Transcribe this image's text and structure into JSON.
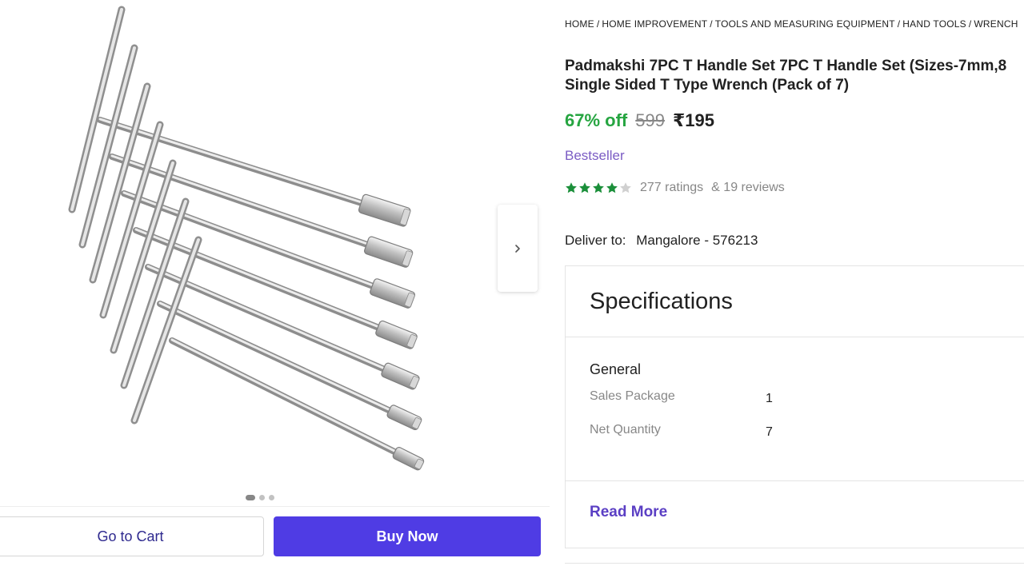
{
  "breadcrumb": [
    "HOME",
    "HOME IMPROVEMENT",
    "TOOLS AND MEASURING EQUIPMENT",
    "HAND TOOLS",
    "WRENCH"
  ],
  "product": {
    "title_line1": "Padmakshi 7PC T Handle Set 7PC T Handle Set (Sizes-7mm,8",
    "title_line2": "Single Sided T Type Wrench (Pack of 7)",
    "discount": "67% off",
    "mrp": "599",
    "price": "₹195",
    "badge": "Bestseller",
    "rating_value": 4,
    "ratings_count": "277 ratings",
    "reviews_count": "& 19 reviews"
  },
  "delivery": {
    "label": "Deliver to:",
    "location": "Mangalore - 576213"
  },
  "specifications": {
    "title": "Specifications",
    "group": "General",
    "rows": [
      {
        "key": "Sales Package",
        "value": "1"
      },
      {
        "key": "Net Quantity",
        "value": "7"
      }
    ],
    "read_more": "Read More"
  },
  "gallery": {
    "image_count": 3,
    "active_index": 0
  },
  "actions": {
    "cart_label": "Go to Cart",
    "buy_label": "Buy Now"
  },
  "colors": {
    "discount": "#26a541",
    "star_filled": "#1b8f3a",
    "star_empty": "#d0d0d0",
    "buy_button": "#4f3ce4",
    "link": "#5b3fc4",
    "badge": "#7b5cc4"
  },
  "icons": {
    "next": "chevron-right-icon",
    "star": "star-icon"
  }
}
